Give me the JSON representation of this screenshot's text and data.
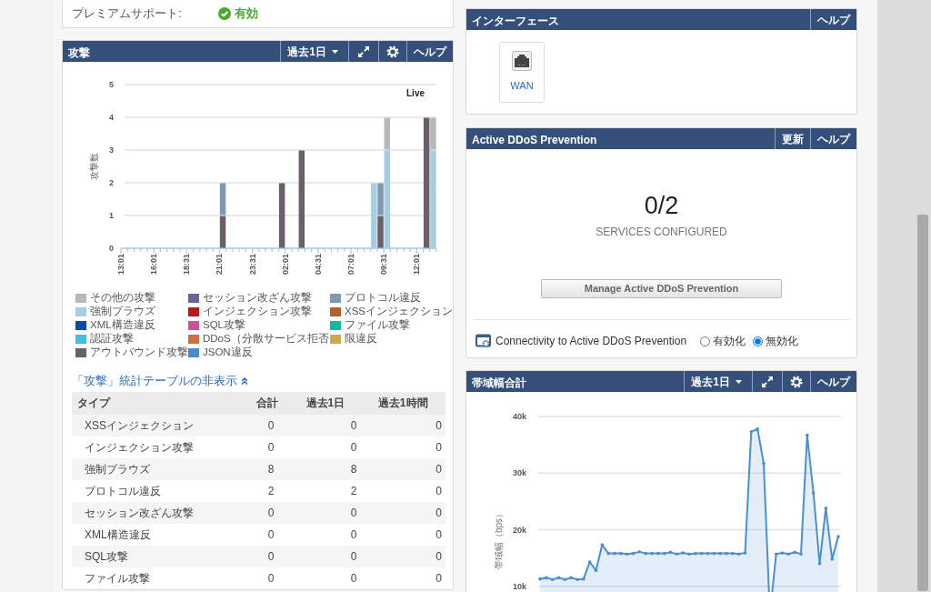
{
  "premium_support": {
    "label": "プレミアムサポート:",
    "status": "有効",
    "enabled": true
  },
  "attacks_panel": {
    "title": "攻撃",
    "period": "過去1日",
    "help": "ヘルプ",
    "live_label": "Live",
    "chart_data": {
      "type": "bar",
      "stacked": true,
      "grid": true,
      "legend": "bottom",
      "ylabel": "攻撃数",
      "ylim": [
        0,
        5
      ],
      "yticks": [
        0,
        1,
        2,
        3,
        4,
        5
      ],
      "categories": [
        "13:01",
        null,
        null,
        null,
        null,
        "16:01",
        null,
        null,
        null,
        null,
        "18:31",
        null,
        null,
        null,
        null,
        "21:01",
        null,
        null,
        null,
        null,
        "23:31",
        null,
        null,
        null,
        null,
        "02:01",
        null,
        null,
        null,
        null,
        "04:31",
        null,
        null,
        null,
        null,
        "07:01",
        null,
        null,
        null,
        null,
        "09:31",
        null,
        null,
        null,
        null,
        "12:01",
        null,
        null
      ],
      "series": [
        {
          "name": "その他の攻撃",
          "color": "#b8b8b8",
          "values": [
            0,
            0,
            0,
            0,
            0,
            0,
            0,
            0,
            0,
            0,
            0,
            0,
            0,
            0,
            0,
            0,
            0,
            0,
            0,
            0,
            0,
            0,
            0,
            0,
            0,
            0,
            0,
            0,
            0,
            0,
            0,
            0,
            0,
            0,
            0,
            0,
            0,
            0,
            0,
            0,
            1,
            0,
            0,
            0,
            0,
            0,
            0,
            1
          ]
        },
        {
          "name": "セッション改ざん攻撃",
          "color": "#6b6391",
          "values": [
            0,
            0,
            0,
            0,
            0,
            0,
            0,
            0,
            0,
            0,
            0,
            0,
            0,
            0,
            0,
            0,
            0,
            0,
            0,
            0,
            0,
            0,
            0,
            0,
            0,
            0,
            0,
            0,
            0,
            0,
            0,
            0,
            0,
            0,
            0,
            0,
            0,
            0,
            0,
            0,
            0,
            0,
            0,
            0,
            0,
            0,
            0,
            0
          ]
        },
        {
          "name": "プロトコル違反",
          "color": "#7d9ab0",
          "values": [
            0,
            0,
            0,
            0,
            0,
            0,
            0,
            0,
            0,
            0,
            0,
            0,
            0,
            0,
            0,
            1,
            0,
            0,
            0,
            0,
            0,
            0,
            0,
            0,
            0,
            0,
            0,
            0,
            0,
            0,
            0,
            0,
            0,
            0,
            0,
            0,
            0,
            0,
            0,
            1,
            0,
            0,
            0,
            0,
            0,
            0,
            0,
            0
          ]
        },
        {
          "name": "強制ブラウズ",
          "color": "#a8cce4",
          "values": [
            0,
            0,
            0,
            0,
            0,
            0,
            0,
            0,
            0,
            0,
            0,
            0,
            0,
            0,
            0,
            0,
            0,
            0,
            0,
            0,
            0,
            0,
            0,
            0,
            0,
            0,
            0,
            0,
            0,
            0,
            0,
            0,
            0,
            0,
            0,
            0,
            0,
            0,
            2,
            0,
            3,
            0,
            0,
            0,
            0,
            0,
            0,
            3
          ]
        },
        {
          "name": "インジェクション攻撃",
          "color": "#b01c1c",
          "values": [
            0,
            0,
            0,
            0,
            0,
            0,
            0,
            0,
            0,
            0,
            0,
            0,
            0,
            0,
            0,
            0,
            0,
            0,
            0,
            0,
            0,
            0,
            0,
            0,
            0,
            0,
            0,
            0,
            0,
            0,
            0,
            0,
            0,
            0,
            0,
            0,
            0,
            0,
            0,
            0,
            0,
            0,
            0,
            0,
            0,
            0,
            0,
            0
          ]
        },
        {
          "name": "XSSインジェクション",
          "color": "#b3612a",
          "values": [
            0,
            0,
            0,
            0,
            0,
            0,
            0,
            0,
            0,
            0,
            0,
            0,
            0,
            0,
            0,
            0,
            0,
            0,
            0,
            0,
            0,
            0,
            0,
            0,
            0,
            0,
            0,
            0,
            0,
            0,
            0,
            0,
            0,
            0,
            0,
            0,
            0,
            0,
            0,
            0,
            0,
            0,
            0,
            0,
            0,
            0,
            0,
            0
          ]
        },
        {
          "name": "XML構造違反",
          "color": "#0b4aa8",
          "values": [
            0,
            0,
            0,
            0,
            0,
            0,
            0,
            0,
            0,
            0,
            0,
            0,
            0,
            0,
            0,
            0,
            0,
            0,
            0,
            0,
            0,
            0,
            0,
            0,
            0,
            0,
            0,
            0,
            0,
            0,
            0,
            0,
            0,
            0,
            0,
            0,
            0,
            0,
            0,
            0,
            0,
            0,
            0,
            0,
            0,
            0,
            0,
            0
          ]
        },
        {
          "name": "SQL攻撃",
          "color": "#c9509b",
          "values": [
            0,
            0,
            0,
            0,
            0,
            0,
            0,
            0,
            0,
            0,
            0,
            0,
            0,
            0,
            0,
            0,
            0,
            0,
            0,
            0,
            0,
            0,
            0,
            0,
            0,
            0,
            0,
            0,
            0,
            0,
            0,
            0,
            0,
            0,
            0,
            0,
            0,
            0,
            0,
            0,
            0,
            0,
            0,
            0,
            0,
            0,
            0,
            0
          ]
        },
        {
          "name": "ファイル攻撃",
          "color": "#10b9a0",
          "values": [
            0,
            0,
            0,
            0,
            0,
            0,
            0,
            0,
            0,
            0,
            0,
            0,
            0,
            0,
            0,
            0,
            0,
            0,
            0,
            0,
            0,
            0,
            0,
            0,
            0,
            0,
            0,
            0,
            0,
            0,
            0,
            0,
            0,
            0,
            0,
            0,
            0,
            0,
            0,
            0,
            0,
            0,
            0,
            0,
            0,
            0,
            0,
            0
          ]
        },
        {
          "name": "認証攻撃",
          "color": "#45bde0",
          "values": [
            0,
            0,
            0,
            0,
            0,
            0,
            0,
            0,
            0,
            0,
            0,
            0,
            0,
            0,
            0,
            0,
            0,
            0,
            0,
            0,
            0,
            0,
            0,
            0,
            0,
            0,
            0,
            0,
            0,
            0,
            0,
            0,
            0,
            0,
            0,
            0,
            0,
            0,
            0,
            0,
            0,
            0,
            0,
            0,
            0,
            0,
            0,
            0
          ]
        },
        {
          "name": "DDoS（分散サービス拒否",
          "color": "#d07040",
          "values": [
            0,
            0,
            0,
            0,
            0,
            0,
            0,
            0,
            0,
            0,
            0,
            0,
            0,
            0,
            0,
            0,
            0,
            0,
            0,
            0,
            0,
            0,
            0,
            0,
            0,
            0,
            0,
            0,
            0,
            0,
            0,
            0,
            0,
            0,
            0,
            0,
            0,
            0,
            0,
            0,
            0,
            0,
            0,
            0,
            0,
            0,
            0,
            0
          ]
        },
        {
          "name": "限違反",
          "color": "#c8aa50",
          "values": [
            0,
            0,
            0,
            0,
            0,
            0,
            0,
            0,
            0,
            0,
            0,
            0,
            0,
            0,
            0,
            0,
            0,
            0,
            0,
            0,
            0,
            0,
            0,
            0,
            0,
            0,
            0,
            0,
            0,
            0,
            0,
            0,
            0,
            0,
            0,
            0,
            0,
            0,
            0,
            0,
            0,
            0,
            0,
            0,
            0,
            0,
            0,
            0
          ]
        },
        {
          "name": "アウトバウンド攻撃",
          "color": "#6b5f69",
          "values": [
            0,
            0,
            0,
            0,
            0,
            0,
            0,
            0,
            0,
            0,
            0,
            0,
            0,
            0,
            0,
            1,
            0,
            0,
            0,
            0,
            0,
            0,
            0,
            0,
            2,
            0,
            0,
            3,
            0,
            0,
            0,
            0,
            0,
            0,
            0,
            0,
            0,
            0,
            0,
            1,
            0,
            0,
            0,
            0,
            0,
            0,
            4,
            0
          ]
        },
        {
          "name": "JSON違反",
          "color": "#4a8ad0",
          "values": [
            0,
            0,
            0,
            0,
            0,
            0,
            0,
            0,
            0,
            0,
            0,
            0,
            0,
            0,
            0,
            0,
            0,
            0,
            0,
            0,
            0,
            0,
            0,
            0,
            0,
            0,
            0,
            0,
            0,
            0,
            0,
            0,
            0,
            0,
            0,
            0,
            0,
            0,
            0,
            0,
            0,
            0,
            0,
            0,
            0,
            0,
            0,
            0
          ]
        }
      ]
    },
    "table_toggle": "「攻撃」統計テーブルの非表示",
    "table": {
      "columns": [
        "タイプ",
        "合計",
        "過去1日",
        "過去1時間"
      ],
      "rows": [
        [
          "XSSインジェクション",
          "0",
          "0",
          "0"
        ],
        [
          "インジェクション攻撃",
          "0",
          "0",
          "0"
        ],
        [
          "強制ブラウズ",
          "8",
          "8",
          "0"
        ],
        [
          "プロトコル違反",
          "2",
          "2",
          "0"
        ],
        [
          "セッション改ざん攻撃",
          "0",
          "0",
          "0"
        ],
        [
          "XML構造違反",
          "0",
          "0",
          "0"
        ],
        [
          "SQL攻撃",
          "0",
          "0",
          "0"
        ],
        [
          "ファイル攻撃",
          "0",
          "0",
          "0"
        ]
      ]
    }
  },
  "interfaces_panel": {
    "title": "インターフェース",
    "help": "ヘルプ",
    "interfaces": [
      {
        "label": "WAN"
      }
    ]
  },
  "ddos_panel": {
    "title": "Active DDoS Prevention",
    "refresh": "更新",
    "help": "ヘルプ",
    "count": "0/2",
    "count_caption": "SERVICES CONFIGURED",
    "manage_button": "Manage Active DDoS Prevention",
    "connectivity_label": "Connectivity to Active DDoS Prevention",
    "options": [
      {
        "label": "有効化",
        "selected": false
      },
      {
        "label": "無効化",
        "selected": true
      }
    ]
  },
  "bandwidth_panel": {
    "title": "帯域幅合計",
    "period": "過去1日",
    "help": "ヘルプ",
    "chart_data": {
      "type": "area",
      "grid": true,
      "ylabel": "帯域幅（bps）",
      "ylim": [
        0,
        40000
      ],
      "yticks": [
        {
          "value": 10000,
          "label": "10k"
        },
        {
          "value": 20000,
          "label": "20k"
        },
        {
          "value": 30000,
          "label": "30k"
        },
        {
          "value": 40000,
          "label": "40k"
        }
      ],
      "series": [
        {
          "color": "#4a8fd6",
          "values": [
            11300,
            11500,
            11200,
            11500,
            11200,
            11500,
            11200,
            11300,
            14300,
            12800,
            17300,
            15800,
            15800,
            15800,
            15700,
            15800,
            16100,
            15800,
            15800,
            15800,
            15800,
            16000,
            15700,
            15900,
            15700,
            15800,
            15800,
            15800,
            15800,
            15800,
            15800,
            15800,
            15700,
            15900,
            37300,
            37800,
            31700,
            5000,
            15700,
            15900,
            15700,
            16000,
            15700,
            36700,
            26500,
            14000,
            23800,
            14800,
            18800
          ]
        }
      ]
    }
  }
}
